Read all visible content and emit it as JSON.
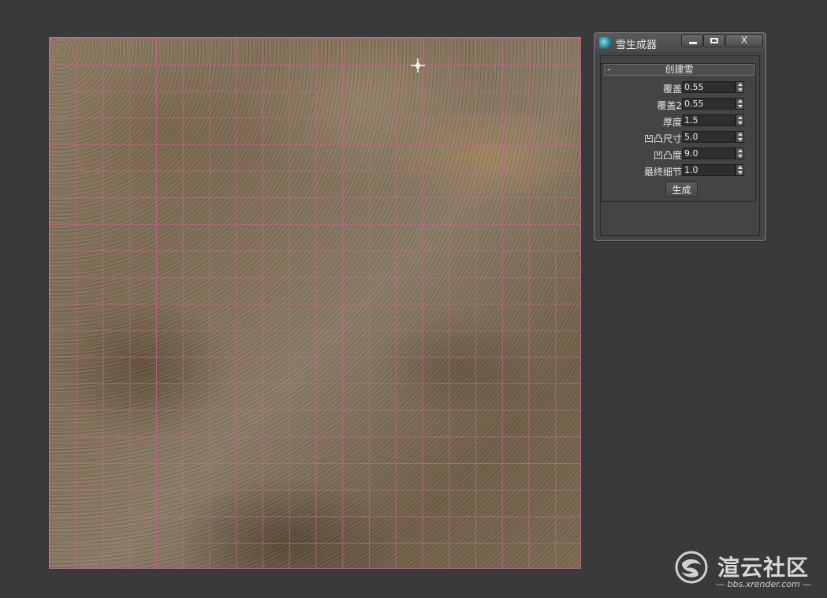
{
  "dialog": {
    "title": "雪生成器",
    "close_glyph": "X"
  },
  "rollout": {
    "toggle": "-",
    "title": "创建雪"
  },
  "params": [
    {
      "label": "覆盖",
      "value": "0.55"
    },
    {
      "label": "覆盖2",
      "value": "0.55"
    },
    {
      "label": "厚度",
      "value": "1.5"
    },
    {
      "label": "凹凸尺寸",
      "value": "5.0"
    },
    {
      "label": "凹凸度",
      "value": "9.0"
    },
    {
      "label": "最终细节",
      "value": "1.0"
    }
  ],
  "generate_label": "生成",
  "watermark": {
    "name": "渲云社区",
    "url": "— bbs.xrender.com —"
  },
  "colors": {
    "background": "#3a3a3a",
    "dialog": "#444444",
    "grid": "#c86496"
  }
}
